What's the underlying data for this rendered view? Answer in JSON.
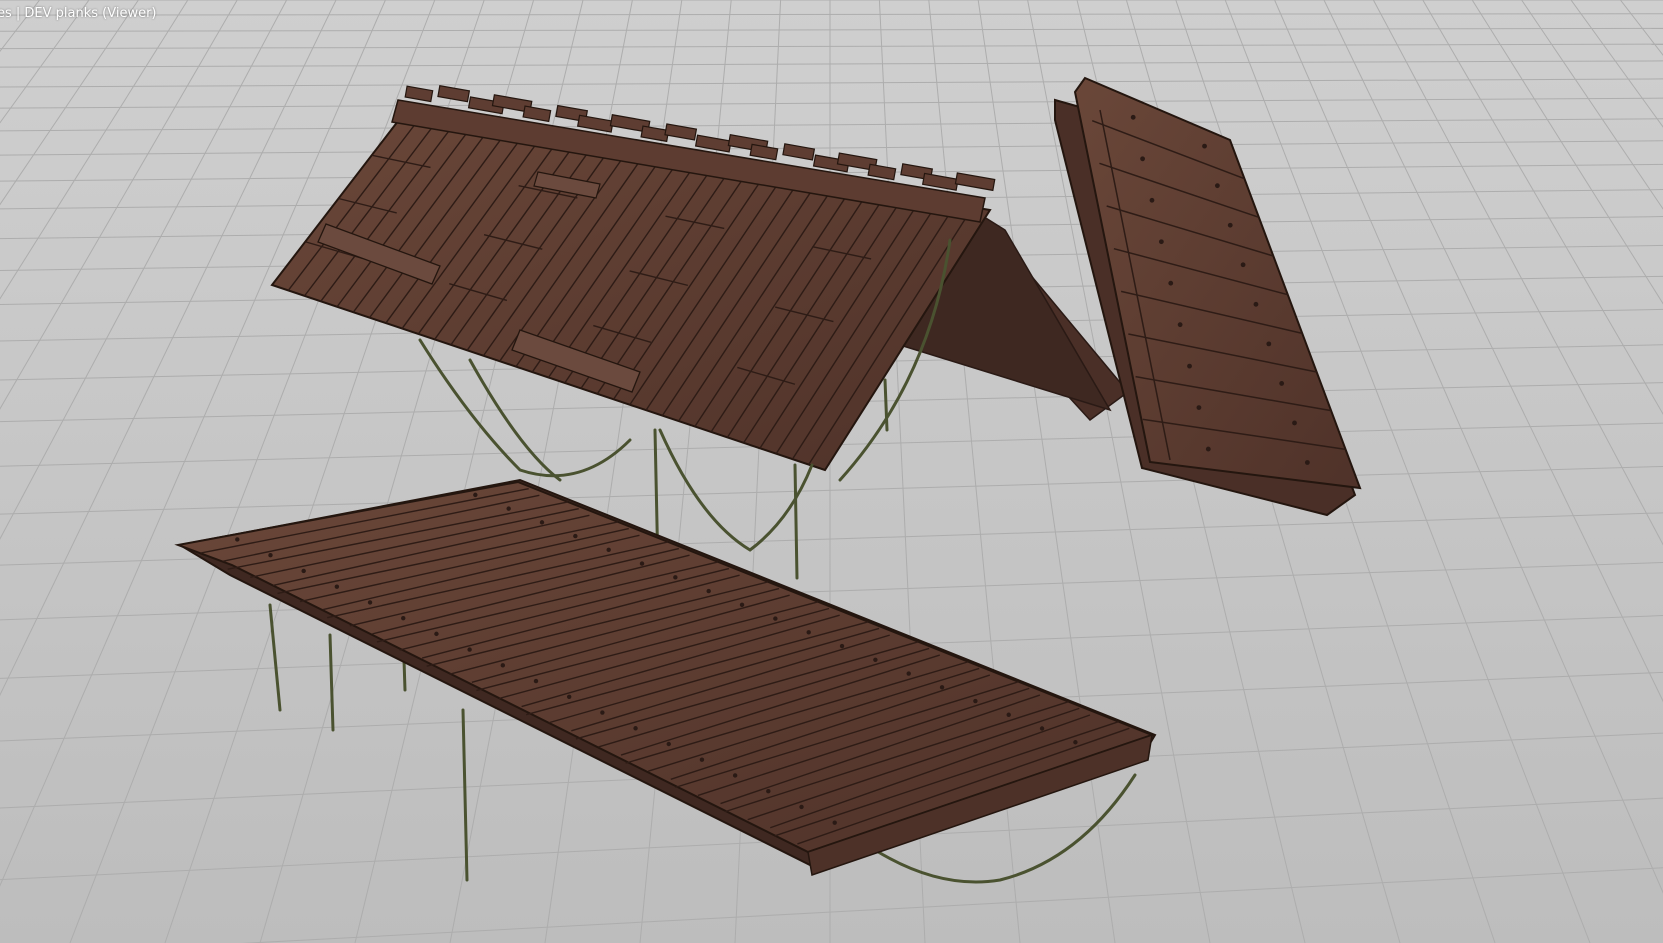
{
  "viewer": {
    "title": "es | DEV planks (Viewer)"
  },
  "colors": {
    "background": "#c6c6c6",
    "grid_line": "#b2b2b2",
    "wood": "#5b3b31",
    "wood_light": "#6b4a3e",
    "wood_dark": "#3d2620",
    "rope": "#4a5230",
    "text": "#ffffff"
  },
  "objects": [
    {
      "name": "plank-roof",
      "label": ""
    },
    {
      "name": "plank-panel",
      "label": ""
    },
    {
      "name": "plank-deck",
      "label": ""
    }
  ]
}
